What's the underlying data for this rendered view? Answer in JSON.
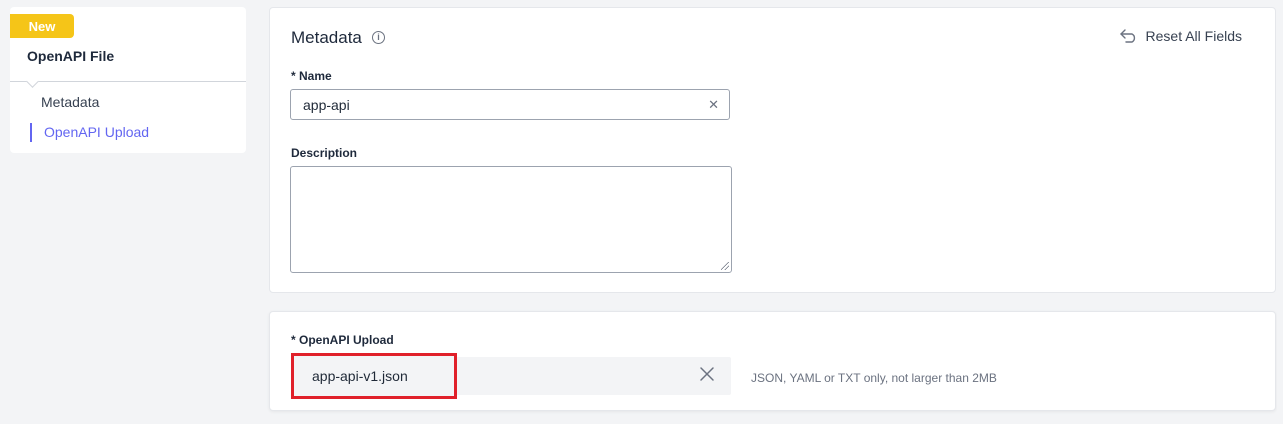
{
  "sidebar": {
    "badge": "New",
    "title": "OpenAPI File",
    "items": [
      {
        "label": "Metadata",
        "active": false
      },
      {
        "label": "OpenAPI Upload",
        "active": true
      }
    ]
  },
  "metadata": {
    "title": "Metadata",
    "info_icon": "i",
    "reset_label": "Reset All Fields",
    "name_label": "* Name",
    "name_value": "app-api",
    "description_label": "Description",
    "description_value": ""
  },
  "upload": {
    "label": "* OpenAPI Upload",
    "file_name": "app-api-v1.json",
    "hint": "JSON, YAML or TXT only, not larger than 2MB"
  },
  "colors": {
    "accent": "#6366f1",
    "badge": "#f5c518",
    "highlight": "#e0202a"
  }
}
